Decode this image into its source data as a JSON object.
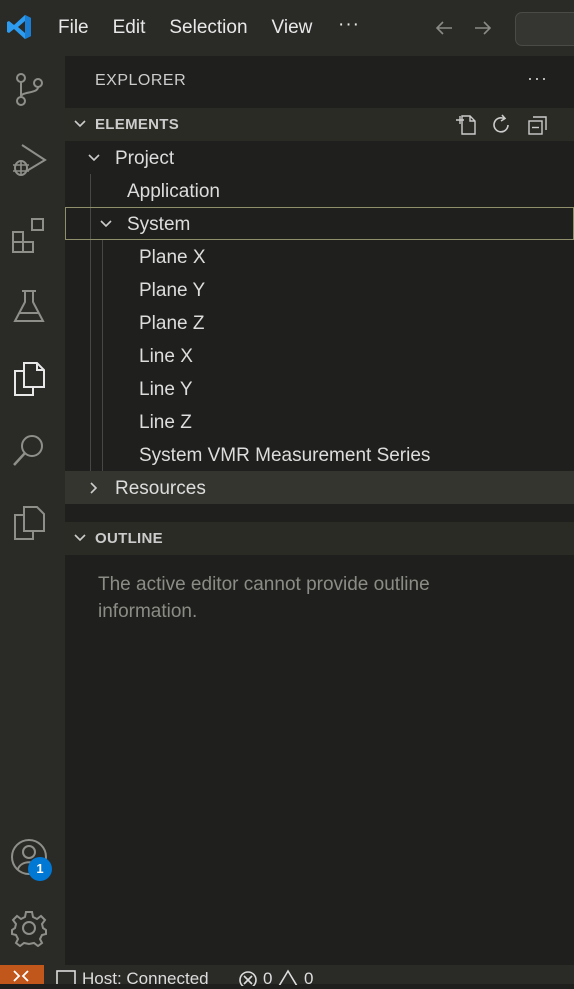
{
  "titlebar": {
    "menus": [
      "File",
      "Edit",
      "Selection",
      "View"
    ],
    "more": "···"
  },
  "activitybar": {
    "icons": [
      "source-control-icon",
      "run-debug-icon",
      "extensions-icon",
      "testing-icon",
      "explorer-icon",
      "search-icon",
      "copy-icon",
      "account-icon",
      "settings-gear-icon"
    ],
    "account_badge": "1"
  },
  "sidebar": {
    "title": "EXPLORER",
    "more": "···",
    "elements_section": {
      "title": "ELEMENTS",
      "tree": {
        "project": "Project",
        "application": "Application",
        "system": "System",
        "system_children": [
          "Plane X",
          "Plane Y",
          "Plane Z",
          "Line X",
          "Line Y",
          "Line Z",
          "System VMR Measurement Series"
        ],
        "resources": "Resources"
      }
    },
    "outline_section": {
      "title": "OUTLINE",
      "message": "The active editor cannot provide outline information."
    }
  },
  "statusbar": {
    "host": "Host: Connected",
    "errors": "0",
    "warnings": "0"
  },
  "colors": {
    "accent_blue": "#0078d4",
    "remote_orange": "#c2571b",
    "selection_border": "#8f8f6b"
  }
}
